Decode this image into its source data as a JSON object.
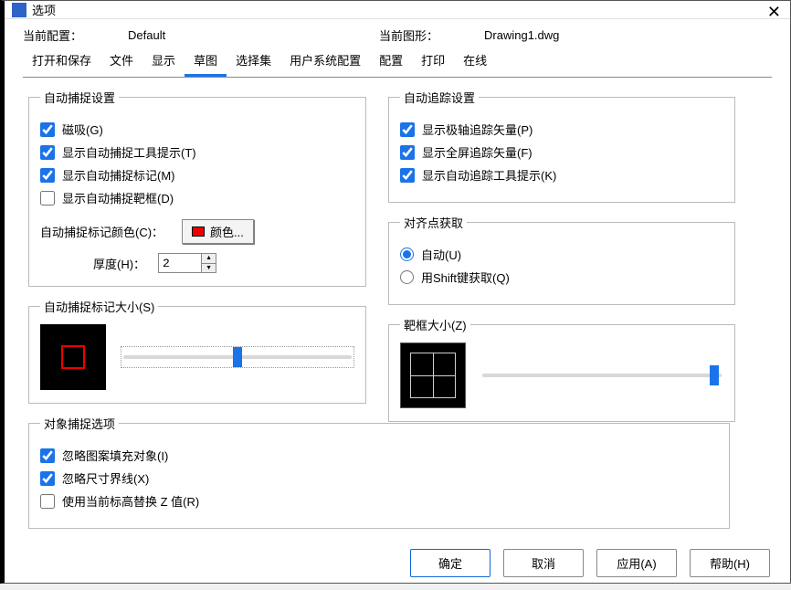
{
  "window": {
    "title": "选项"
  },
  "info": {
    "profile_label": "当前配置：",
    "profile_value": "Default",
    "drawing_label": "当前图形：",
    "drawing_value": "Drawing1.dwg"
  },
  "tabs": {
    "t0": "打开和保存",
    "t1": "文件",
    "t2": "显示",
    "t3": "草图",
    "t4": "选择集",
    "t5": "用户系统配置",
    "t6": "配置",
    "t7": "打印",
    "t8": "在线"
  },
  "autosnap": {
    "legend": "自动捕捉设置",
    "magnet": "磁吸(G)",
    "tooltip": "显示自动捕捉工具提示(T)",
    "marker": "显示自动捕捉标记(M)",
    "aperture": "显示自动捕捉靶框(D)",
    "color_label": "自动捕捉标记颜色(C)：",
    "color_btn": "颜色...",
    "thickness_label": "厚度(H)：",
    "thickness_value": "2"
  },
  "marker_size": {
    "legend": "自动捕捉标记大小(S)"
  },
  "osnap_opts": {
    "legend": "对象捕捉选项",
    "ignore_hatch": "忽略图案填充对象(I)",
    "ignore_dim": "忽略尺寸界线(X)",
    "replace_z": "使用当前标高替换 Z 值(R)"
  },
  "autotrack": {
    "legend": "自动追踪设置",
    "polar_vec": "显示极轴追踪矢量(P)",
    "full_vec": "显示全屏追踪矢量(F)",
    "track_tip": "显示自动追踪工具提示(K)"
  },
  "acquisition": {
    "legend": "对齐点获取",
    "auto": "自动(U)",
    "shift": "用Shift键获取(Q)"
  },
  "aperture_size": {
    "legend": "靶框大小(Z)"
  },
  "footer": {
    "ok": "确定",
    "cancel": "取消",
    "apply": "应用(A)",
    "help": "帮助(H)"
  }
}
